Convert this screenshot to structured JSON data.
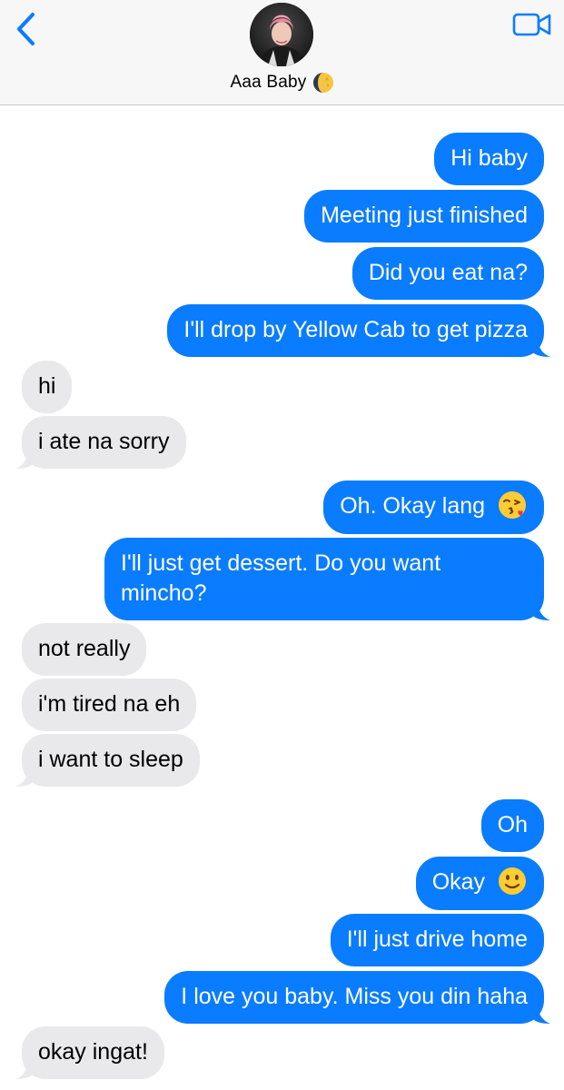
{
  "header": {
    "contact_name": "Aaa Baby",
    "name_icon": "moon-icon",
    "back_icon": "chevron-left-icon",
    "video_icon": "video-camera-icon"
  },
  "colors": {
    "accent": "#0a7cff",
    "incoming_bubble": "#e9e9eb",
    "header_bg": "#f7f7f7"
  },
  "messages": [
    {
      "side": "out",
      "text": "Hi baby"
    },
    {
      "side": "out",
      "text": "Meeting just finished"
    },
    {
      "side": "out",
      "text": "Did you eat na?"
    },
    {
      "side": "out",
      "text": "I'll drop by Yellow Cab to get pizza"
    },
    {
      "side": "in",
      "text": "hi"
    },
    {
      "side": "in",
      "text": "i ate na sorry"
    },
    {
      "side": "out",
      "text": "Oh. Okay lang",
      "emoji": "kissing-face-icon"
    },
    {
      "side": "out",
      "text": "I'll just get dessert. Do you want mincho?"
    },
    {
      "side": "in",
      "text": "not really"
    },
    {
      "side": "in",
      "text": "i'm tired na eh"
    },
    {
      "side": "in",
      "text": "i want to sleep"
    },
    {
      "side": "out",
      "text": "Oh"
    },
    {
      "side": "out",
      "text": "Okay",
      "emoji": "slightly-smiling-face-icon"
    },
    {
      "side": "out",
      "text": "I'll just drive home"
    },
    {
      "side": "out",
      "text": "I love you baby. Miss you din haha"
    },
    {
      "side": "in",
      "text": "okay ingat!"
    }
  ]
}
